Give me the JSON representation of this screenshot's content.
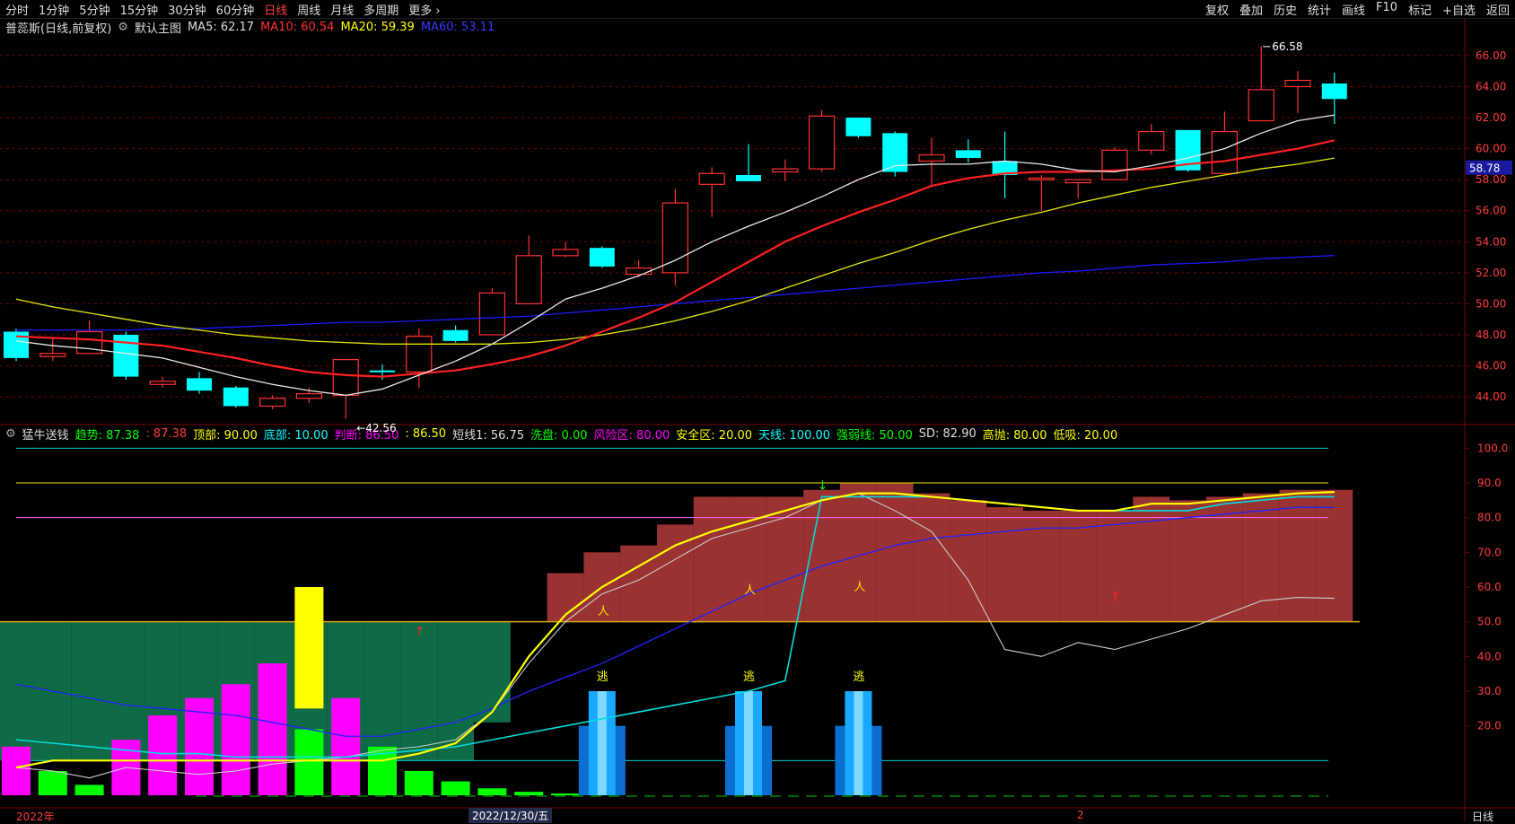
{
  "topbar": {
    "tabs": [
      "分时",
      "1分钟",
      "5分钟",
      "15分钟",
      "30分钟",
      "60分钟",
      "日线",
      "周线",
      "月线",
      "多周期",
      "更多 ›"
    ],
    "active_tab": 6,
    "tools": [
      "复权",
      "叠加",
      "历史",
      "统计",
      "画线",
      "F10",
      "标记",
      "+自选",
      "返回"
    ]
  },
  "main_legend": {
    "name": "普蕊斯(日线,前复权)",
    "layout": "默认主图",
    "ma5": "MA5: 62.17",
    "ma10": "MA10: 60.54",
    "ma20": "MA20: 59.39",
    "ma60": "MA60: 53.11"
  },
  "sub_legend": {
    "name": "猛牛送钱",
    "items": [
      {
        "text": "趋势: 87.38",
        "color": "#00ff00"
      },
      {
        "text": ": 87.38",
        "color": "#ff3b3b"
      },
      {
        "text": "顶部: 90.00",
        "color": "#ffff00"
      },
      {
        "text": "底部: 10.00",
        "color": "#00ffff"
      },
      {
        "text": "判断: 86.50",
        "color": "#ff00ff"
      },
      {
        "text": ": 86.50",
        "color": "#ffff00"
      },
      {
        "text": "短线1: 56.75",
        "color": "#dddddd"
      },
      {
        "text": "洗盘: 0.00",
        "color": "#00ff00"
      },
      {
        "text": "风险区: 80.00",
        "color": "#ff00ff"
      },
      {
        "text": "安全区: 20.00",
        "color": "#ffff00"
      },
      {
        "text": "天线: 100.00",
        "color": "#00ffff"
      },
      {
        "text": "强弱线: 50.00",
        "color": "#00ff00"
      },
      {
        "text": "SD: 82.90",
        "color": "#dddddd"
      },
      {
        "text": "高抛: 80.00",
        "color": "#ffff00"
      },
      {
        "text": "低吸: 20.00",
        "color": "#ffff00"
      }
    ]
  },
  "colors": {
    "up": "#ff3030",
    "down": "#00ffff",
    "ma5": "#e8e8e8",
    "ma10": "#ff2020",
    "ma20": "#e6e600",
    "ma60": "#1a1aff",
    "grid": "#7a0000"
  },
  "chart_data": [
    {
      "type": "candlestick",
      "title": "普蕊斯(日线,前复权)",
      "ylim": [
        42.5,
        67.5
      ],
      "yticks": [
        "66.00",
        "64.00",
        "62.00",
        "60.00",
        "58.00",
        "56.00",
        "54.00",
        "52.00",
        "50.00",
        "48.00",
        "46.00",
        "44.00"
      ],
      "yticks_values": [
        66,
        64,
        62,
        60,
        58,
        56,
        54,
        52,
        50,
        48,
        46,
        44
      ],
      "current_price": "58.78",
      "current_price_value": 58.78,
      "high_label": "66.58",
      "low_label": "42.56",
      "candles": [
        [
          48.2,
          46.5,
          46.3,
          48.4
        ],
        [
          46.6,
          46.8,
          46.3,
          47.8
        ],
        [
          46.8,
          48.2,
          46.8,
          48.9
        ],
        [
          48.0,
          45.3,
          45.1,
          48.2
        ],
        [
          44.8,
          45.0,
          44.6,
          45.3
        ],
        [
          45.2,
          44.4,
          44.2,
          45.6
        ],
        [
          44.6,
          43.4,
          43.3,
          44.7
        ],
        [
          43.4,
          43.9,
          43.2,
          44.1
        ],
        [
          43.9,
          44.2,
          43.6,
          44.6
        ],
        [
          44.1,
          46.4,
          42.6,
          46.4
        ],
        [
          45.7,
          45.6,
          45.1,
          46.1
        ],
        [
          45.6,
          47.9,
          44.6,
          48.4
        ],
        [
          48.3,
          47.6,
          47.5,
          48.6
        ],
        [
          48.0,
          50.7,
          48.0,
          51.0
        ],
        [
          50.0,
          53.1,
          50.0,
          54.4
        ],
        [
          53.1,
          53.5,
          53.0,
          54.0
        ],
        [
          53.6,
          52.4,
          52.3,
          53.7
        ],
        [
          51.9,
          52.3,
          51.7,
          52.8
        ],
        [
          52.0,
          56.5,
          51.2,
          57.4
        ],
        [
          57.7,
          58.4,
          55.6,
          58.8
        ],
        [
          58.3,
          57.9,
          57.9,
          60.3
        ],
        [
          58.5,
          58.7,
          57.9,
          59.3
        ],
        [
          58.7,
          62.1,
          58.5,
          62.5
        ],
        [
          62.0,
          60.8,
          60.7,
          62.0
        ],
        [
          61.0,
          58.5,
          58.2,
          61.1
        ],
        [
          59.2,
          59.6,
          57.5,
          60.7
        ],
        [
          59.9,
          59.4,
          59.1,
          60.6
        ],
        [
          59.2,
          58.3,
          56.8,
          61.1
        ],
        [
          58.1,
          58.1,
          56.0,
          58.3
        ],
        [
          57.8,
          58.0,
          56.8,
          58.0
        ],
        [
          58.0,
          59.9,
          58.0,
          60.1
        ],
        [
          59.9,
          61.1,
          59.6,
          61.6
        ],
        [
          61.2,
          58.6,
          58.5,
          61.2
        ],
        [
          58.4,
          61.1,
          58.4,
          62.4
        ],
        [
          61.8,
          63.8,
          61.8,
          66.6
        ],
        [
          64.0,
          64.4,
          62.3,
          65.0
        ],
        [
          64.2,
          63.2,
          61.6,
          64.9
        ]
      ],
      "ma5": [
        47.6,
        47.3,
        47.1,
        46.8,
        46.5,
        45.9,
        45.3,
        44.8,
        44.4,
        44.1,
        44.5,
        45.4,
        46.3,
        47.4,
        48.8,
        50.3,
        51.0,
        51.8,
        52.8,
        54.0,
        55.0,
        55.9,
        56.9,
        58.0,
        58.9,
        59.0,
        59.0,
        59.2,
        59.0,
        58.6,
        58.5,
        58.9,
        59.4,
        60.0,
        61.0,
        61.8,
        62.17
      ],
      "ma10": [
        47.9,
        47.8,
        47.7,
        47.5,
        47.3,
        46.9,
        46.5,
        46.0,
        45.6,
        45.4,
        45.3,
        45.5,
        45.7,
        46.1,
        46.6,
        47.3,
        48.2,
        49.1,
        50.1,
        51.4,
        52.7,
        54.0,
        55.0,
        55.9,
        56.7,
        57.6,
        58.1,
        58.4,
        58.5,
        58.5,
        58.6,
        58.7,
        59.0,
        59.2,
        59.6,
        60.0,
        60.54
      ],
      "ma20": [
        50.3,
        49.8,
        49.4,
        49.0,
        48.6,
        48.3,
        48.0,
        47.8,
        47.6,
        47.5,
        47.4,
        47.4,
        47.4,
        47.4,
        47.5,
        47.7,
        48.0,
        48.4,
        48.9,
        49.5,
        50.2,
        51.0,
        51.8,
        52.6,
        53.3,
        54.1,
        54.8,
        55.4,
        55.9,
        56.5,
        57.0,
        57.5,
        57.9,
        58.3,
        58.7,
        59.0,
        59.39
      ],
      "ma60": [
        48.3,
        48.3,
        48.3,
        48.3,
        48.4,
        48.4,
        48.5,
        48.6,
        48.7,
        48.8,
        48.8,
        48.9,
        49.0,
        49.1,
        49.2,
        49.4,
        49.6,
        49.8,
        50.0,
        50.2,
        50.4,
        50.6,
        50.8,
        51.0,
        51.2,
        51.4,
        51.6,
        51.8,
        52.0,
        52.1,
        52.3,
        52.5,
        52.6,
        52.7,
        52.9,
        53.0,
        53.11
      ]
    },
    {
      "type": "indicator",
      "title": "猛牛送钱",
      "ylim": [
        0,
        105
      ],
      "yticks": [
        "100.0",
        "90.0",
        "80.0",
        "70.0",
        "60.0",
        "50.0",
        "40.0",
        "30.0",
        "20.0"
      ],
      "yticks_values": [
        100,
        90,
        80,
        70,
        60,
        50,
        40,
        30,
        20
      ],
      "levels": {
        "tianxian": 100,
        "top": 90,
        "risk": 80,
        "strong": 50,
        "bottom": 10
      },
      "band": [
        10,
        10,
        10,
        10,
        10,
        10,
        10,
        10,
        10,
        10,
        10,
        10,
        10,
        21,
        50,
        64,
        70,
        72,
        78,
        86,
        86,
        86,
        88,
        90,
        90,
        87,
        85,
        83,
        82,
        82,
        82,
        86,
        85,
        86,
        87,
        88,
        88
      ],
      "trend": [
        8,
        10,
        10,
        10,
        10,
        10,
        10,
        10,
        10,
        10,
        10,
        12,
        15,
        24,
        40,
        52,
        60,
        66,
        72,
        76,
        79,
        82,
        85,
        87,
        87,
        86,
        85,
        84,
        83,
        82,
        82,
        84,
        84,
        85,
        86,
        87,
        87.38
      ],
      "short": [
        8,
        7,
        5,
        8,
        7,
        6,
        7,
        9,
        10,
        11,
        13,
        14,
        16,
        24,
        38,
        50,
        58,
        62,
        68,
        74,
        77,
        80,
        85,
        87,
        82,
        76,
        62,
        42,
        40,
        44,
        42,
        45,
        48,
        52,
        56,
        57,
        56.75
      ],
      "sd": [
        32,
        30,
        28,
        26,
        25,
        24,
        23,
        21,
        19,
        17,
        17,
        19,
        21,
        25,
        30,
        34,
        38,
        43,
        48,
        53,
        58,
        62,
        66,
        69,
        72,
        74,
        75,
        76,
        77,
        77,
        78,
        79,
        80,
        81,
        82,
        83,
        82.9
      ],
      "cyan_line": [
        16,
        15,
        14,
        13,
        12,
        12,
        11,
        11,
        11,
        11,
        12,
        13,
        14,
        16,
        18,
        20,
        22,
        24,
        26,
        28,
        30,
        33,
        86,
        86,
        86,
        86,
        85,
        84,
        83,
        82,
        82,
        82,
        82,
        84,
        85,
        86,
        86
      ],
      "bars_magenta": [
        {
          "i": 0,
          "v": 14
        },
        {
          "i": 3,
          "v": 16
        },
        {
          "i": 4,
          "v": 23
        },
        {
          "i": 5,
          "v": 28
        },
        {
          "i": 6,
          "v": 32
        },
        {
          "i": 7,
          "v": 38
        },
        {
          "i": 9,
          "v": 28
        }
      ],
      "bars_green": [
        {
          "i": 1,
          "v": 7
        },
        {
          "i": 2,
          "v": 3
        },
        {
          "i": 8,
          "v": 19
        },
        {
          "i": 10,
          "v": 14
        },
        {
          "i": 11,
          "v": 7
        },
        {
          "i": 12,
          "v": 4
        },
        {
          "i": 13,
          "v": 2
        },
        {
          "i": 14,
          "v": 1
        },
        {
          "i": 15,
          "v": 0.5
        }
      ],
      "bars_yellow": [
        {
          "i": 8,
          "v0": 25,
          "v1": 60
        }
      ],
      "bars_blue": [
        {
          "i": 16,
          "label": "逃"
        },
        {
          "i": 20,
          "label": "逃"
        },
        {
          "i": 23,
          "label": "逃"
        }
      ],
      "date_left": "2022年",
      "date_mid": "2022/12/30/五",
      "date_right": "2",
      "period_label": "日线"
    }
  ]
}
